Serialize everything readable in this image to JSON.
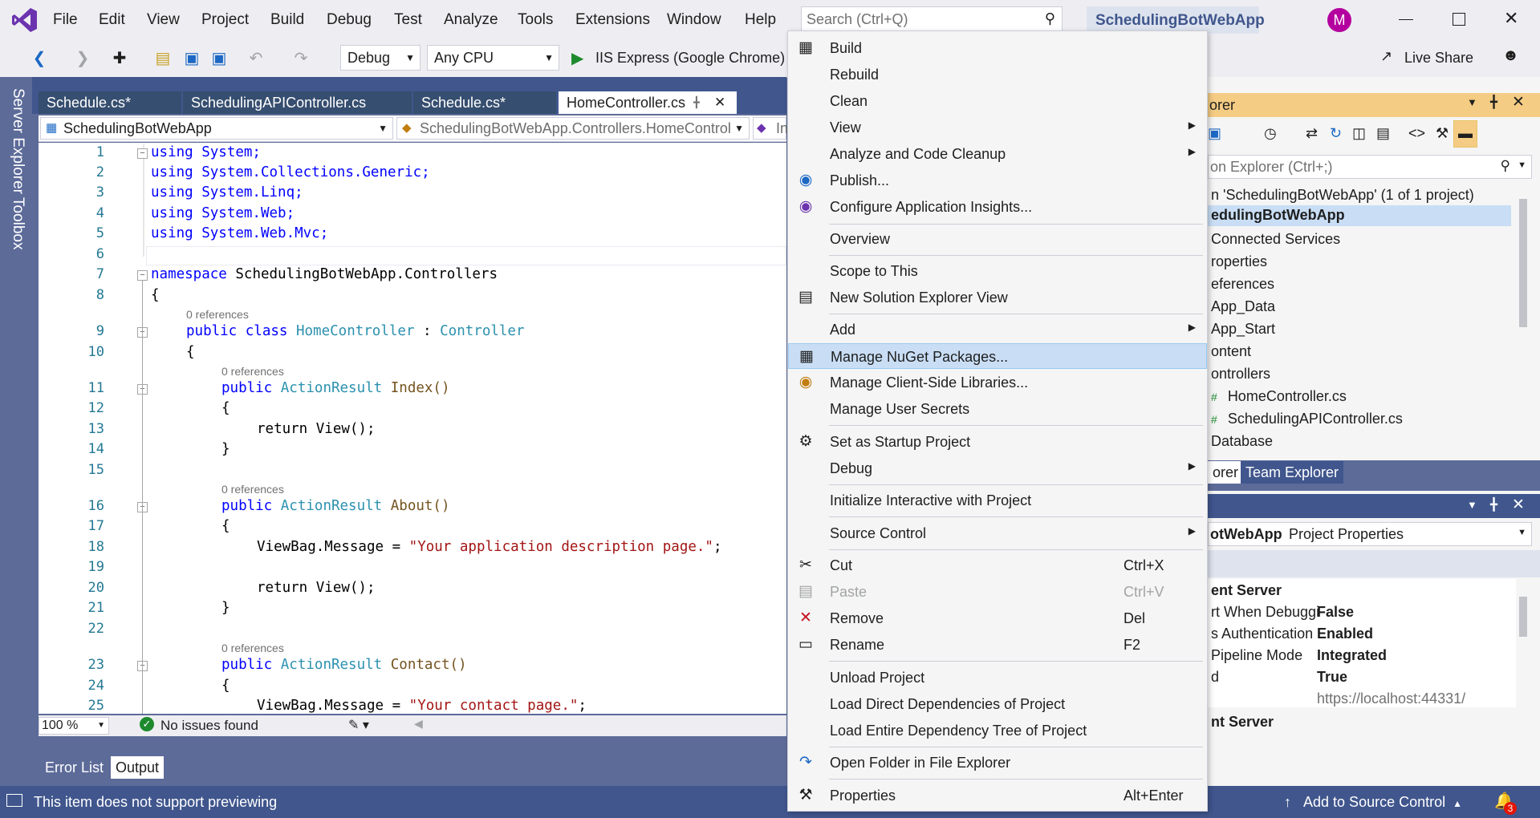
{
  "window": {
    "menu_items": [
      "File",
      "Edit",
      "View",
      "Project",
      "Build",
      "Debug",
      "Test",
      "Analyze",
      "Tools",
      "Extensions",
      "Window",
      "Help"
    ],
    "search_placeholder": "Search (Ctrl+Q)",
    "solution_name": "SchedulingBotWebApp",
    "avatar_letter": "M",
    "live_share": "Live Share"
  },
  "toolbar": {
    "config": "Debug",
    "platform": "Any CPU",
    "run_target": "IIS Express (Google Chrome)"
  },
  "side_strip": {
    "server_explorer": "Server Explorer",
    "toolbox": "Toolbox"
  },
  "tabs": [
    "Schedule.cs*",
    "SchedulingAPIController.cs",
    "Schedule.cs*",
    "HomeController.cs"
  ],
  "navbar": {
    "project": "SchedulingBotWebApp",
    "class": "SchedulingBotWebApp.Controllers.HomeControl",
    "member": "In"
  },
  "editor": {
    "line_numbers": [
      "1",
      "2",
      "3",
      "4",
      "5",
      "6",
      "7",
      "8",
      "9",
      "10",
      "11",
      "12",
      "13",
      "14",
      "15",
      "16",
      "17",
      "18",
      "19",
      "20",
      "21",
      "22",
      "23",
      "24",
      "25"
    ],
    "references": "0 references",
    "using1": "using System;",
    "using2": "using System.Collections.Generic;",
    "using3": "using System.Linq;",
    "using4": "using System.Web;",
    "using5": "using System.Web.Mvc;",
    "ns_kw": "namespace",
    "ns_name": "SchedulingBotWebApp.Controllers",
    "open_brace": "{",
    "close_brace": "}",
    "class_kw": "public class",
    "class_name": "HomeController",
    "colon": ":",
    "base_class": "Controller",
    "public_kw": "public",
    "action_result": "ActionResult",
    "index_sig": "Index()",
    "about_sig": "About()",
    "contact_sig": "Contact()",
    "return_view": "return View();",
    "viewbag": "ViewBag.Message =",
    "about_str": "\"Your application description page.\"",
    "contact_str": "\"Your contact page.\"",
    "semicolon": ";"
  },
  "editor_status": {
    "zoom": "100 %",
    "issues": "No issues found"
  },
  "bottom_tabs": {
    "error_list": "Error List",
    "output": "Output"
  },
  "status_bar": {
    "message": "This item does not support previewing",
    "source_control": "Add to Source Control",
    "notif_count": "3"
  },
  "solution_explorer": {
    "title": "orer",
    "search": "on Explorer (Ctrl+;)",
    "items": [
      "n 'SchedulingBotWebApp' (1 of 1 project)",
      "edulingBotWebApp",
      "Connected Services",
      "roperties",
      "eferences",
      "App_Data",
      "App_Start",
      "ontent",
      "ontrollers",
      "HomeController.cs",
      "SchedulingAPIController.cs",
      "Database"
    ],
    "tab_left": "orer",
    "tab_team": "Team Explorer"
  },
  "properties": {
    "header_bold": "otWebApp",
    "header_rest": "Project Properties",
    "section1": "ent Server",
    "rows": [
      {
        "name": "rt When Debuggi",
        "value": "False"
      },
      {
        "name": "s Authentication",
        "value": "Enabled"
      },
      {
        "name": "Pipeline Mode",
        "value": "Integrated"
      },
      {
        "name": "d",
        "value": "True"
      },
      {
        "name": "",
        "value": "https://localhost:44331/"
      }
    ],
    "section2": "nt Server"
  },
  "context_menu": {
    "build": "Build",
    "rebuild": "Rebuild",
    "clean": "Clean",
    "view": "View",
    "analyze": "Analyze and Code Cleanup",
    "publish": "Publish...",
    "insights": "Configure Application Insights...",
    "overview": "Overview",
    "scope": "Scope to This",
    "new_se_view": "New Solution Explorer View",
    "add": "Add",
    "nuget": "Manage NuGet Packages...",
    "client_libs": "Manage Client-Side Libraries...",
    "user_secrets": "Manage User Secrets",
    "startup": "Set as Startup Project",
    "debug": "Debug",
    "interactive": "Initialize Interactive with Project",
    "source_control": "Source Control",
    "cut": "Cut",
    "cut_sc": "Ctrl+X",
    "paste": "Paste",
    "paste_sc": "Ctrl+V",
    "remove": "Remove",
    "remove_sc": "Del",
    "rename": "Rename",
    "rename_sc": "F2",
    "unload": "Unload Project",
    "load_direct": "Load Direct Dependencies of Project",
    "load_tree": "Load Entire Dependency Tree of Project",
    "open_folder": "Open Folder in File Explorer",
    "properties": "Properties",
    "properties_sc": "Alt+Enter"
  }
}
